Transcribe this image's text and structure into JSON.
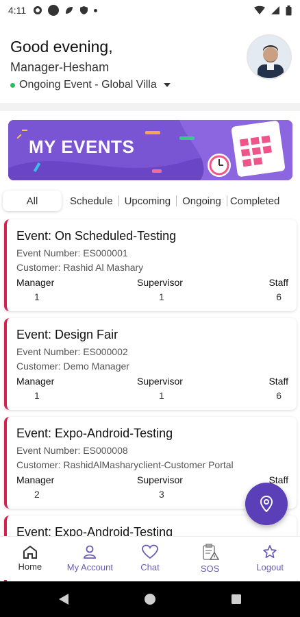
{
  "status_bar": {
    "time": "4:11",
    "icons": [
      "gear-icon",
      "circle-icon",
      "leaf-icon",
      "shield-icon",
      "dot-icon"
    ],
    "right_icons": [
      "wifi-icon",
      "signal-icon",
      "battery-icon"
    ]
  },
  "header": {
    "greeting": "Good evening,",
    "user_name": "Manager-Hesham",
    "ongoing_event": "Ongoing Event - Global Villa",
    "status_color": "#2ebd5a"
  },
  "banner": {
    "title": "MY EVENTS",
    "bg_color": "#7a55d3"
  },
  "tabs": [
    {
      "label": "All",
      "active": true
    },
    {
      "label": "Schedule",
      "active": false
    },
    {
      "label": "Upcoming",
      "active": false
    },
    {
      "label": "Ongoing",
      "active": false
    },
    {
      "label": "Completed",
      "active": false
    }
  ],
  "labels": {
    "manager": "Manager",
    "supervisor": "Supervisor",
    "staff": "Staff"
  },
  "events": [
    {
      "title": "Event: On Scheduled-Testing",
      "number": "Event Number: ES000001",
      "customer": "Customer: Rashid Al Mashary",
      "manager": "1",
      "supervisor": "1",
      "staff": "6"
    },
    {
      "title": "Event: Design Fair",
      "number": "Event Number: ES000002",
      "customer": "Customer: Demo Manager",
      "manager": "1",
      "supervisor": "1",
      "staff": "6"
    },
    {
      "title": "Event: Expo-Android-Testing",
      "number": "Event Number: ES000008",
      "customer": "Customer: RashidAlMasharyclient-Customer Portal",
      "manager": "2",
      "supervisor": "3",
      "staff": ""
    },
    {
      "title": "Event: Expo-Android-Testing",
      "number": "",
      "customer": "",
      "manager": "",
      "supervisor": "",
      "staff": ""
    }
  ],
  "fab": {
    "icon": "location-pin-icon"
  },
  "bottom_nav": [
    {
      "label": "Home",
      "icon": "home-icon",
      "active": true
    },
    {
      "label": "My Account",
      "icon": "user-icon",
      "active": false
    },
    {
      "label": "Chat",
      "icon": "heart-icon",
      "active": false
    },
    {
      "label": "SOS",
      "icon": "sos-clipboard-icon",
      "active": false
    },
    {
      "label": "Logout",
      "icon": "star-icon",
      "active": false
    }
  ],
  "accent_color": "#d6204e",
  "brand_color": "#5b3fb8"
}
